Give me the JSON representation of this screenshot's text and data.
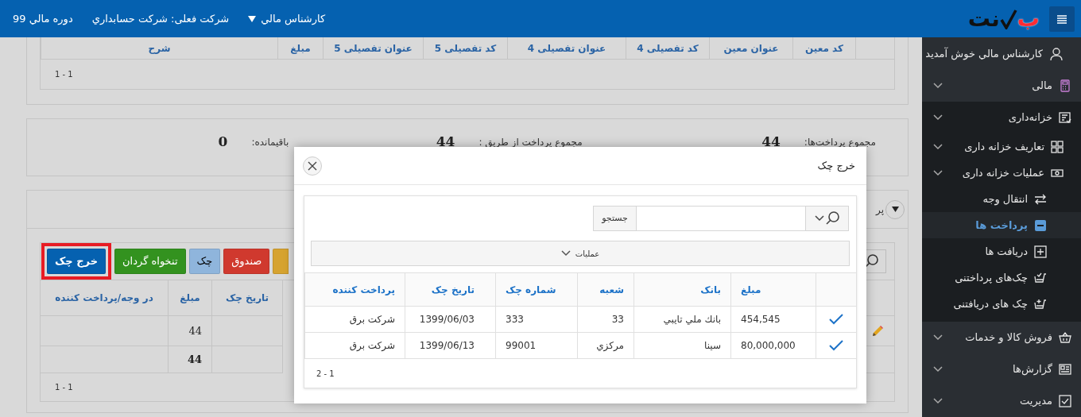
{
  "header": {
    "logo": {
      "part_1": "ب",
      "part_2": "نت"
    },
    "user_menu": "کارشناس مالي",
    "company": "شرکت فعلی: شرکت حسابداري",
    "fiscal_year": "دوره مالي 99"
  },
  "sidebar": {
    "greeting": "کارشناس مالي خوش آمديد",
    "items": [
      {
        "label": "مالی",
        "kind": "calculator",
        "expanded": false
      },
      {
        "label": "خزانه‌داری",
        "kind": "checklist",
        "expanded": true,
        "children": [
          {
            "label": "تعاریف خزانه داری",
            "kind": "grid",
            "expanded": false
          },
          {
            "label": "عملیات خزانه داری",
            "kind": "money",
            "expanded": true,
            "children": [
              {
                "label": "انتقال وجه",
                "kind": "transfer",
                "selected": false
              },
              {
                "label": "پرداخت ها",
                "kind": "minus",
                "selected": true
              },
              {
                "label": "دریافت ها",
                "kind": "plus",
                "selected": false
              },
              {
                "label": "چک‌های پرداختنی",
                "kind": "cart-check",
                "selected": false
              },
              {
                "label": "چک های دریافتنی",
                "kind": "cart-plus",
                "selected": false
              }
            ]
          }
        ]
      },
      {
        "label": "فروش کالا و خدمات",
        "kind": "basket",
        "expanded": false
      },
      {
        "label": "گزارش‌ها",
        "kind": "news",
        "expanded": false
      },
      {
        "label": "مدیریت",
        "kind": "checkbox",
        "expanded": false
      }
    ]
  },
  "entries_table": {
    "columns": [
      "کد معین",
      "عنوان معین",
      "کد تفصیلی 4",
      "عنوان تفصیلی 4",
      "کد تفصیلی 5",
      "عنوان تفصیلی 5",
      "مبلغ",
      "شرح"
    ],
    "footer": "1 - 1"
  },
  "summary": [
    {
      "label": "مجموع پرداخت‌ها:",
      "value": "44"
    },
    {
      "label": "مجموع پرداخت از طریق :",
      "value": "44"
    },
    {
      "label": "باقیمانده:",
      "value": "0"
    }
  ],
  "payments_panel": {
    "title": "پر",
    "toolbar": [
      {
        "kind": "yellow",
        "highlighted": false
      },
      {
        "label": "صندوق",
        "kind": "red",
        "highlighted": false
      },
      {
        "label": "چک",
        "kind": "light",
        "highlighted": false
      },
      {
        "label": "تنخواه گردان",
        "kind": "green",
        "highlighted": false
      },
      {
        "label": "خرج چک",
        "kind": "blue",
        "highlighted": true
      }
    ],
    "columns": [
      "تاریخ چک",
      "مبلغ",
      "در وجه/پرداخت کننده"
    ],
    "rows": [
      {
        "amount": "44",
        "editable": true,
        "total": false
      },
      {
        "amount": "44",
        "editable": false,
        "total": true
      }
    ],
    "footer": "1 - 1"
  },
  "dialog": {
    "title": "خرج چک",
    "search_button": "جستجو",
    "actions": "عملیات",
    "columns": [
      "مبلغ",
      "بانک",
      "شعبه",
      "شماره چک",
      "تاریخ چک",
      "پرداخت کننده"
    ],
    "rows": [
      {
        "checked": true,
        "cells": [
          "454,545",
          "بانك ملي تايبي",
          "33",
          "333",
          "1399/06/03",
          "شرکت برق"
        ]
      },
      {
        "checked": true,
        "cells": [
          "80,000,000",
          "سينا",
          "مرکزي",
          "99001",
          "1399/06/13",
          "شرکت برق"
        ]
      }
    ],
    "footer": "2 - 1"
  }
}
